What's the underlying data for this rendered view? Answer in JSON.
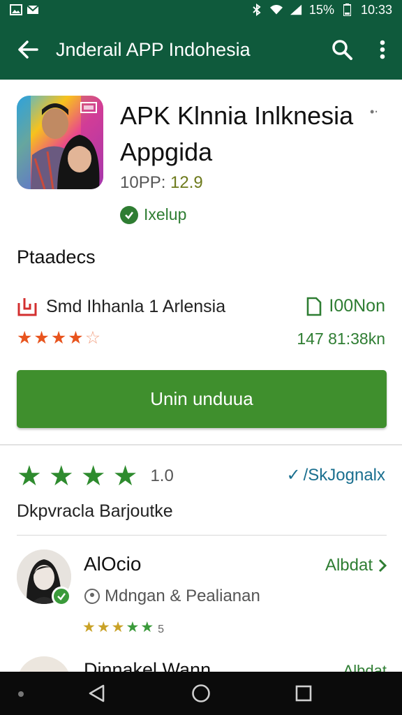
{
  "status_bar": {
    "battery": "15%",
    "time": "10:33"
  },
  "app_bar": {
    "title": "Jnderail APP  Indohesia"
  },
  "app": {
    "name": "APK Klnnia Inlknesia Appgida",
    "version_label": "10PP: ",
    "version_value": "12.9",
    "status": "Ixelup",
    "publisher": "Ptaadecs",
    "developer": "Smd Ihhanla 1 Arlensia",
    "rating_stars": 4,
    "size_label": "I00Non",
    "size_sub": "147 81:38kn"
  },
  "actions": {
    "install_label": "Unin unduua"
  },
  "ratings": {
    "score": "1.0",
    "review_link": "/SkJognalx",
    "section_title": "Dkpvracla Barjoutke"
  },
  "review": {
    "name": "AlOcio",
    "subtitle": "Mdngan & Pealianan",
    "stars_score": "5",
    "reply_label": "Albdat"
  },
  "peek_review": {
    "name": "Dinnakel Wann",
    "link": "Albdat"
  },
  "colors": {
    "app_bar": "#0f5a3c",
    "install_button": "#3f8f2d",
    "accent_green": "#2e7d32",
    "star_orange": "#e8541e"
  },
  "icons": {
    "back": "arrow-left-icon",
    "search": "search-icon",
    "more": "more-vert-icon"
  }
}
